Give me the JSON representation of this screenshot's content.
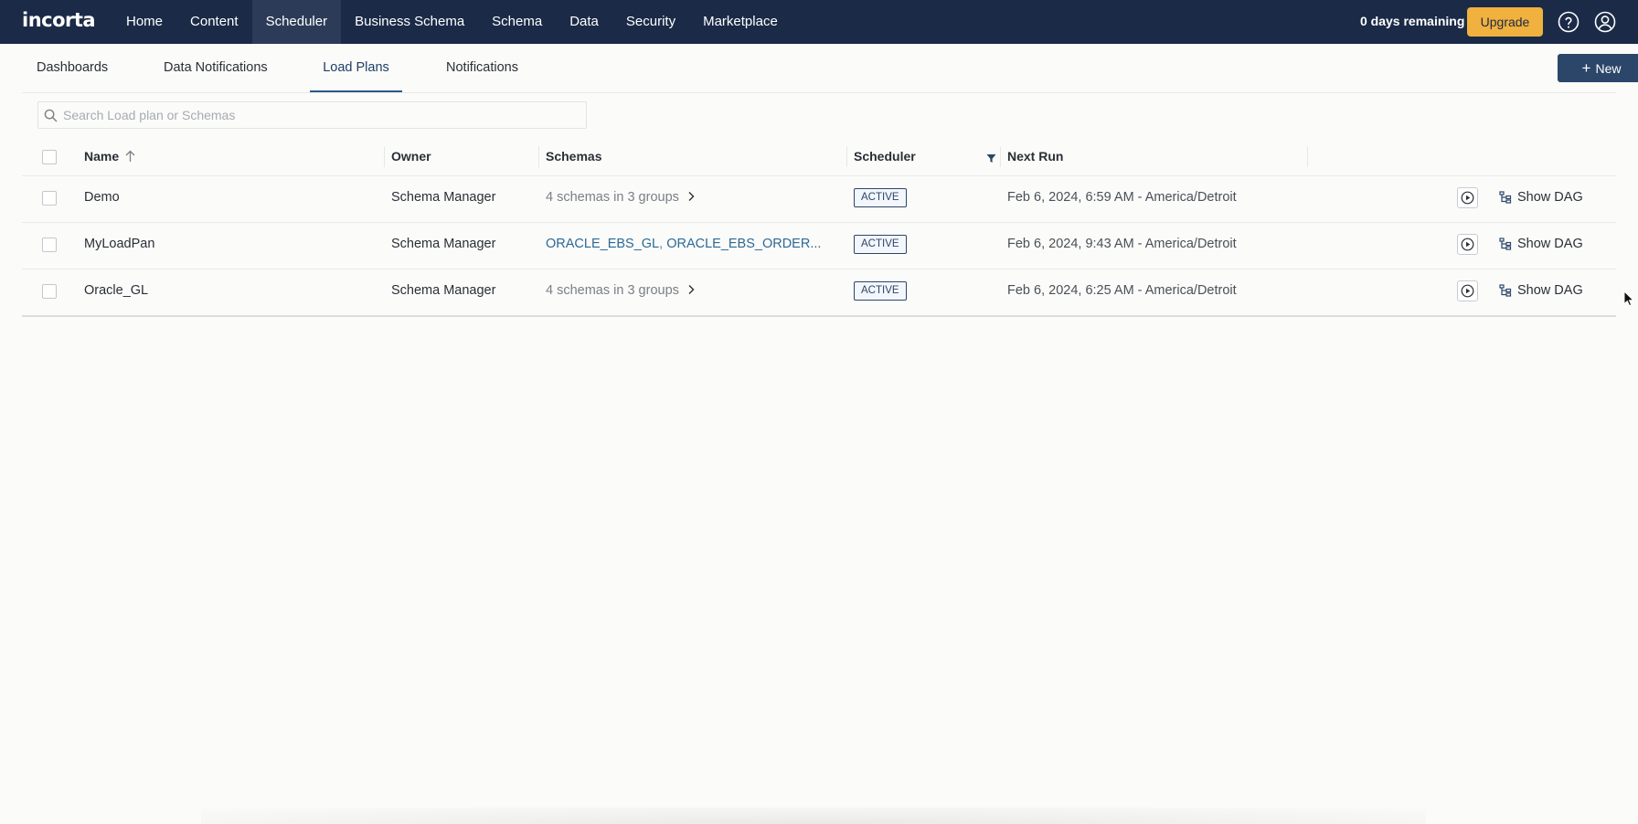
{
  "app": {
    "logo": "incorta",
    "nav": [
      "Home",
      "Content",
      "Scheduler",
      "Business Schema",
      "Schema",
      "Data",
      "Security",
      "Marketplace"
    ],
    "active_nav": "Scheduler",
    "days_remaining": "0 days remaining",
    "upgrade_label": "Upgrade",
    "icons": [
      "help-icon",
      "user-icon"
    ]
  },
  "tabs": {
    "items": [
      "Dashboards",
      "Data Notifications",
      "Load Plans",
      "Notifications"
    ],
    "active": "Load Plans",
    "new_label": "New"
  },
  "search": {
    "placeholder": "Search Load plan or Schemas",
    "value": ""
  },
  "table": {
    "columns": {
      "name": "Name",
      "owner": "Owner",
      "schemas": "Schemas",
      "scheduler": "Scheduler",
      "next_run": "Next Run"
    },
    "sort": {
      "column": "Name",
      "direction": "ascending"
    },
    "rows": [
      {
        "name": "Demo",
        "owner": "Schema Manager",
        "schemas_text": "4 schemas in 3 groups",
        "schema_links": [],
        "status": "ACTIVE",
        "next_run": "Feb 6, 2024, 6:59 AM - America/Detroit",
        "action": "Show DAG"
      },
      {
        "name": "MyLoadPan",
        "owner": "Schema Manager",
        "schemas_text": "",
        "schema_links": [
          "ORACLE_EBS_GL",
          "ORACLE_EBS_ORDER..."
        ],
        "status": "ACTIVE",
        "next_run": "Feb 6, 2024, 9:43 AM - America/Detroit",
        "action": "Show DAG"
      },
      {
        "name": "Oracle_GL",
        "owner": "Schema Manager",
        "schemas_text": "4 schemas in 3 groups",
        "schema_links": [],
        "status": "ACTIVE",
        "next_run": "Feb 6, 2024, 6:25 AM - America/Detroit",
        "action": "Show DAG"
      }
    ]
  },
  "colors": {
    "nav_bg": "#1b2a47",
    "upgrade_bg": "#f0b13e",
    "primary": "#2c4669",
    "link": "#2b6a96"
  }
}
